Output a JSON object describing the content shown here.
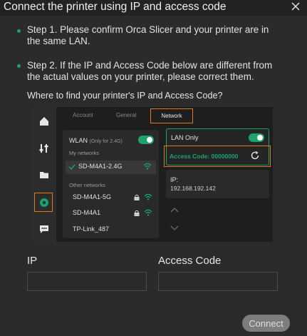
{
  "dialog": {
    "title": "Connect the printer using IP and access code"
  },
  "steps": [
    "Step 1. Please confirm Orca Slicer and your printer are in the same LAN.",
    "Step 2. If the IP and Access Code below are different from the actual values on your printer, please correct them."
  ],
  "help_text": "Where to find your printer's IP and Access Code?",
  "illustration": {
    "tabs": [
      "Account",
      "General",
      "Network"
    ],
    "active_tab": "Network",
    "wlan_label": "WLAN",
    "wlan_note": "(Only for 2.4G)",
    "my_networks_label": "My networks",
    "my_networks": [
      "SD-M4A1-2.4G"
    ],
    "other_networks_label": "Other networks",
    "other_networks": [
      "SD-M4A1-5G",
      "SD-M4A1",
      "TP-Link_487"
    ],
    "lan_only_label": "LAN Only",
    "access_code_label": "Access Code:",
    "access_code_value": "00000000",
    "ip_label": "IP:",
    "ip_value": "192.168.192.142"
  },
  "form": {
    "ip_label": "IP",
    "ip_value": "",
    "access_code_label": "Access Code",
    "access_code_value": ""
  },
  "connect_label": "Connect",
  "colors": {
    "accent_green": "#1aa36a",
    "highlight_orange": "#e07a1f",
    "background": "#2b2b2c",
    "button_disabled": "#7d7d7f"
  },
  "icons": [
    "close-icon",
    "home-icon",
    "sliders-icon",
    "folder-icon",
    "settings-icon",
    "chat-icon",
    "check-icon",
    "wifi-icon",
    "lock-icon",
    "refresh-icon",
    "chevron-up-icon",
    "chevron-down-icon"
  ]
}
